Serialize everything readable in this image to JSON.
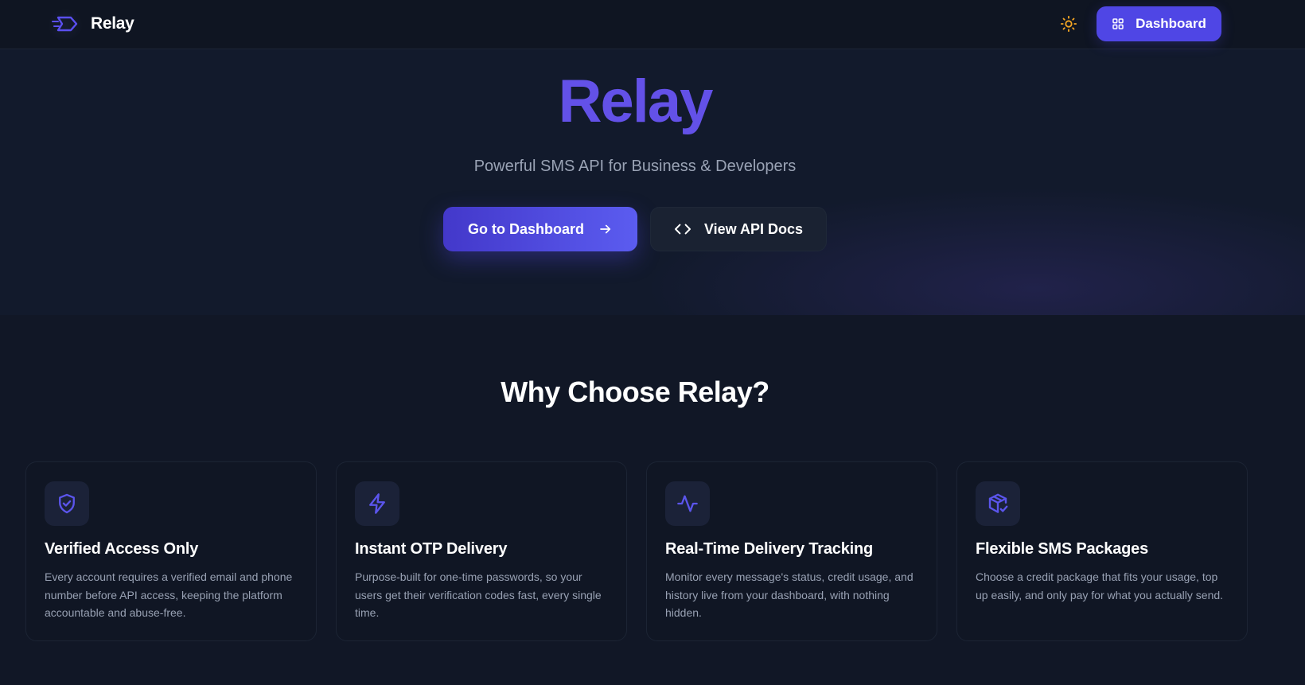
{
  "header": {
    "logo_text": "Relay",
    "logo_icon": "relay-send-icon",
    "theme_icon": "sun-icon",
    "dashboard_label": "Dashboard",
    "dashboard_icon": "grid-icon"
  },
  "hero": {
    "title": "Relay",
    "subtitle": "Powerful SMS API for Business & Developers",
    "primary_button": "Go to Dashboard",
    "primary_icon": "arrow-right-icon",
    "secondary_button": "View API Docs",
    "secondary_icon": "code-icon"
  },
  "features": {
    "title": "Why Choose Relay?",
    "items": [
      {
        "icon": "shield-check-icon",
        "title": "Verified Access Only",
        "description": "Every account requires a verified email and phone number before API access, keeping the platform accountable and abuse-free."
      },
      {
        "icon": "lightning-icon",
        "title": "Instant OTP Delivery",
        "description": "Purpose-built for one-time passwords, so your users get their verification codes fast, every single time."
      },
      {
        "icon": "activity-icon",
        "title": "Real-Time Delivery Tracking",
        "description": "Monitor every message's status, credit usage, and history live from your dashboard, with nothing hidden."
      },
      {
        "icon": "package-check-icon",
        "title": "Flexible SMS Packages",
        "description": "Choose a credit package that fits your usage, top up easily, and only pay for what you actually send."
      }
    ]
  },
  "colors": {
    "accent": "#4f46e5",
    "hero_title": "#6351e8",
    "background": "#111726",
    "theme_icon": "#f5a623"
  }
}
